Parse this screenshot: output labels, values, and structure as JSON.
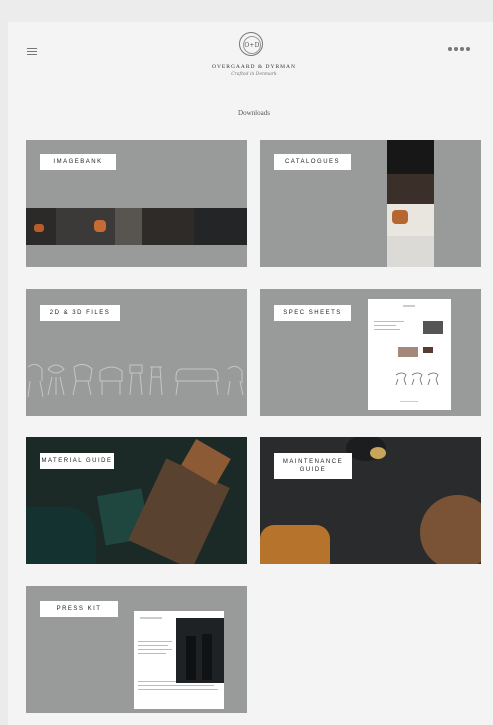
{
  "header": {
    "brand": "OVERGAARD & DYRMAN",
    "tagline": "Crafted in Denmark",
    "logo_monogram": "O+D",
    "social_icons": [
      "instagram-icon",
      "pinterest-icon",
      "facebook-icon",
      "vimeo-icon"
    ]
  },
  "page_title": "Downloads",
  "tiles": [
    {
      "label": "IMAGEBANK"
    },
    {
      "label": "CATALOGUES"
    },
    {
      "label": "2D & 3D FILES"
    },
    {
      "label": "SPEC SHEETS"
    },
    {
      "label": "MATERIAL GUIDE"
    },
    {
      "label": "MAINTENANCE GUIDE"
    },
    {
      "label": "PRESS KIT"
    }
  ],
  "colors": {
    "page_bg": "#f4f4f4",
    "tile_bg": "#999a9a",
    "label_bg": "#ffffff"
  }
}
